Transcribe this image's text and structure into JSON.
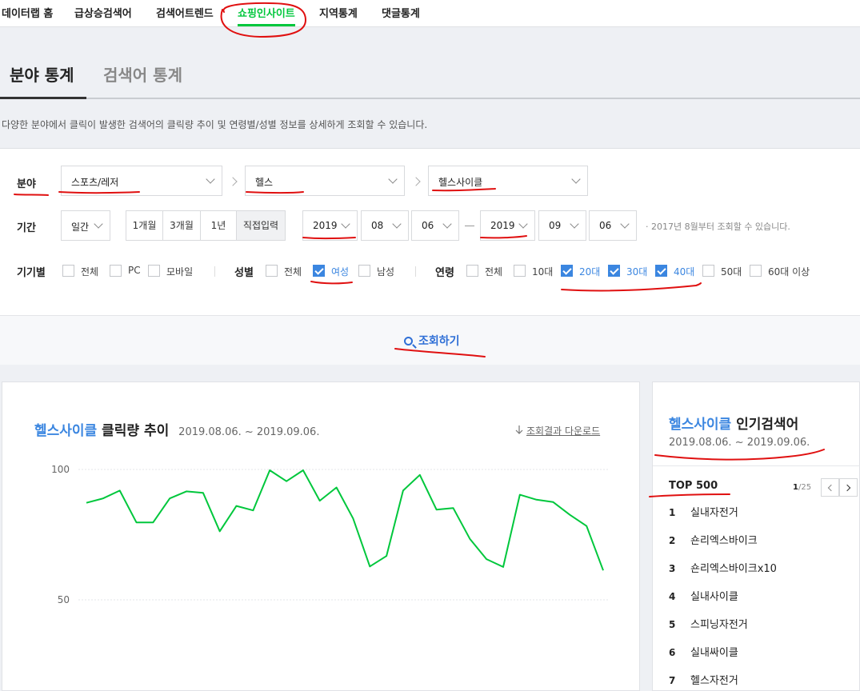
{
  "topnav": {
    "items": [
      "데이터랩 홈",
      "급상승검색어",
      "검색어트렌드",
      "쇼핑인사이트",
      "지역통계",
      "댓글통계"
    ],
    "active_index": 3
  },
  "tabs": {
    "category": "분야 통계",
    "keyword": "검색어 통계"
  },
  "description": "다양한 분야에서 클릭이 발생한 검색어의 클릭량 추이 및 연령별/성별 정보를 상세하게 조회할 수 있습니다.",
  "filter": {
    "category_label": "분야",
    "category1": "스포츠/레저",
    "category2": "헬스",
    "category3": "헬스사이클",
    "period_label": "기간",
    "time_unit": "일간",
    "period_buttons": [
      "1개월",
      "3개월",
      "1년",
      "직접입력"
    ],
    "active_period": "직접입력",
    "start": {
      "year": "2019",
      "month": "08",
      "day": "06"
    },
    "end": {
      "year": "2019",
      "month": "09",
      "day": "06"
    },
    "period_note": "· 2017년 8월부터 조회할 수 있습니다.",
    "device_label": "기기별",
    "devices": [
      {
        "label": "전체",
        "checked": false
      },
      {
        "label": "PC",
        "checked": false
      },
      {
        "label": "모바일",
        "checked": false
      }
    ],
    "gender_label": "성별",
    "genders": [
      {
        "label": "전체",
        "checked": false
      },
      {
        "label": "여성",
        "checked": true
      },
      {
        "label": "남성",
        "checked": false
      }
    ],
    "age_label": "연령",
    "ages": [
      {
        "label": "전체",
        "checked": false
      },
      {
        "label": "10대",
        "checked": false
      },
      {
        "label": "20대",
        "checked": true
      },
      {
        "label": "30대",
        "checked": true
      },
      {
        "label": "40대",
        "checked": true
      },
      {
        "label": "50대",
        "checked": false
      },
      {
        "label": "60대 이상",
        "checked": false
      }
    ],
    "search_button": "조회하기"
  },
  "chart": {
    "keyword": "헬스사이클",
    "title_suffix": "클릭량 추이",
    "date_range": "2019.08.06. ~ 2019.09.06.",
    "download": "조회결과 다운로드"
  },
  "chart_data": {
    "type": "line",
    "title": "헬스사이클 클릭량 추이",
    "xlabel": "",
    "ylabel": "",
    "x": [
      "2019-08-06",
      "2019-08-07",
      "2019-08-08",
      "2019-08-09",
      "2019-08-10",
      "2019-08-11",
      "2019-08-12",
      "2019-08-13",
      "2019-08-14",
      "2019-08-15",
      "2019-08-16",
      "2019-08-17",
      "2019-08-18",
      "2019-08-19",
      "2019-08-20",
      "2019-08-21",
      "2019-08-22",
      "2019-08-23",
      "2019-08-24",
      "2019-08-25",
      "2019-08-26",
      "2019-08-27",
      "2019-08-28",
      "2019-08-29",
      "2019-08-30",
      "2019-08-31",
      "2019-09-01",
      "2019-09-02",
      "2019-09-03",
      "2019-09-04",
      "2019-09-05",
      "2019-09-06"
    ],
    "series": [
      {
        "values": [
          87.2,
          88.9,
          91.9,
          79.7,
          79.7,
          88.9,
          91.6,
          91.0,
          76.3,
          86.0,
          84.3,
          99.7,
          95.5,
          99.7,
          88.0,
          93.1,
          81.2,
          62.8,
          66.8,
          91.9,
          97.9,
          84.6,
          85.2,
          73.4,
          65.6,
          62.6,
          90.3,
          88.4,
          87.5,
          82.6,
          78.3,
          61.3
        ]
      }
    ],
    "yticks": [
      100,
      50
    ],
    "ylim": [
      40,
      105
    ],
    "grid": true,
    "line_color": "#00c73c"
  },
  "ranking": {
    "keyword": "헬스사이클",
    "title_suffix": "인기검색어",
    "date_range": "2019.08.06. ~ 2019.09.06.",
    "top_label": "TOP 500",
    "page_current": "1",
    "page_total": "/25",
    "items": [
      {
        "rank": "1",
        "term": "실내자전거"
      },
      {
        "rank": "2",
        "term": "숀리엑스바이크"
      },
      {
        "rank": "3",
        "term": "숀리엑스바이크x10"
      },
      {
        "rank": "4",
        "term": "실내사이클"
      },
      {
        "rank": "5",
        "term": "스피닝자전거"
      },
      {
        "rank": "6",
        "term": "실내싸이클"
      },
      {
        "rank": "7",
        "term": "헬스자전거"
      }
    ]
  }
}
